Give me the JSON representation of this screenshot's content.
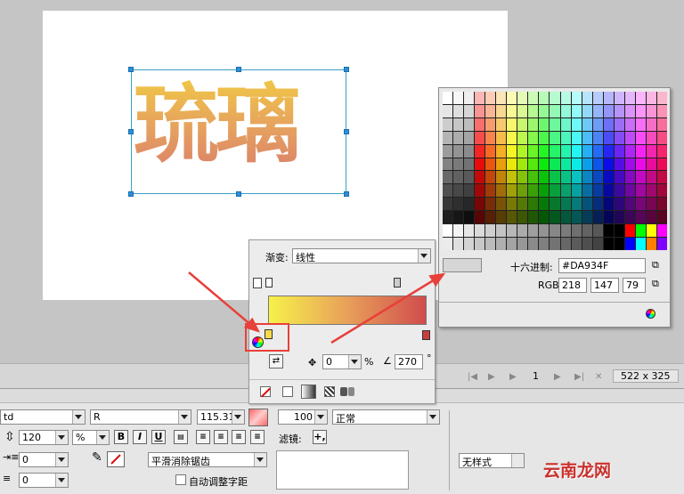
{
  "stage": {
    "art_text": "琉璃",
    "size_text": "522 x 325",
    "frame_number": "1"
  },
  "gradient_panel": {
    "type_label": "渐变:",
    "type_value": "线性",
    "rotation_value": "0",
    "percent_symbol": "%",
    "angle_value": "270",
    "degree_symbol": "°"
  },
  "swatch_panel": {
    "hex_label": "十六进制:",
    "hex_value": "#DA934F",
    "rgb_label": "RGB:",
    "r": "218",
    "g": "147",
    "b": "79"
  },
  "properties": {
    "font_family_value": "td",
    "font_style_value": "R",
    "font_size_value": "115.31",
    "line_spacing_value": "120",
    "unit_value": "%",
    "bold_label": "B",
    "italic_label": "I",
    "underline_label": "U",
    "indent_value": "0",
    "margin_value": "0",
    "opacity_value": "100",
    "blend_value": "正常",
    "filter_label": "滤镜:",
    "filter_add": "+,",
    "antialias_value": "平滑消除锯齿",
    "autokern_label": "自动调整字距",
    "style_value": "无样式"
  },
  "watermark": "云南龙网",
  "colors": {
    "hex": "#DA934F",
    "gradient_start": "#f7f14a",
    "gradient_end": "#d04c4c",
    "highlight": "#e8403a"
  }
}
